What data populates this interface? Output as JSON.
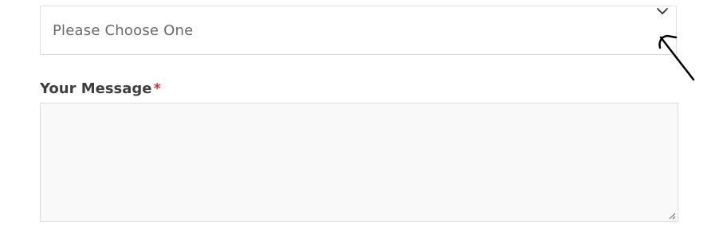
{
  "select": {
    "value": "Please Choose One",
    "icon": "chevron-down-icon"
  },
  "message": {
    "label": "Your Message",
    "required_mark": "*",
    "value": ""
  },
  "annotation": {
    "icon": "arrow-annotation-icon"
  },
  "colors": {
    "required": "#d63638",
    "border": "#dcdcdc",
    "textarea_bg": "#f9f9f9"
  }
}
